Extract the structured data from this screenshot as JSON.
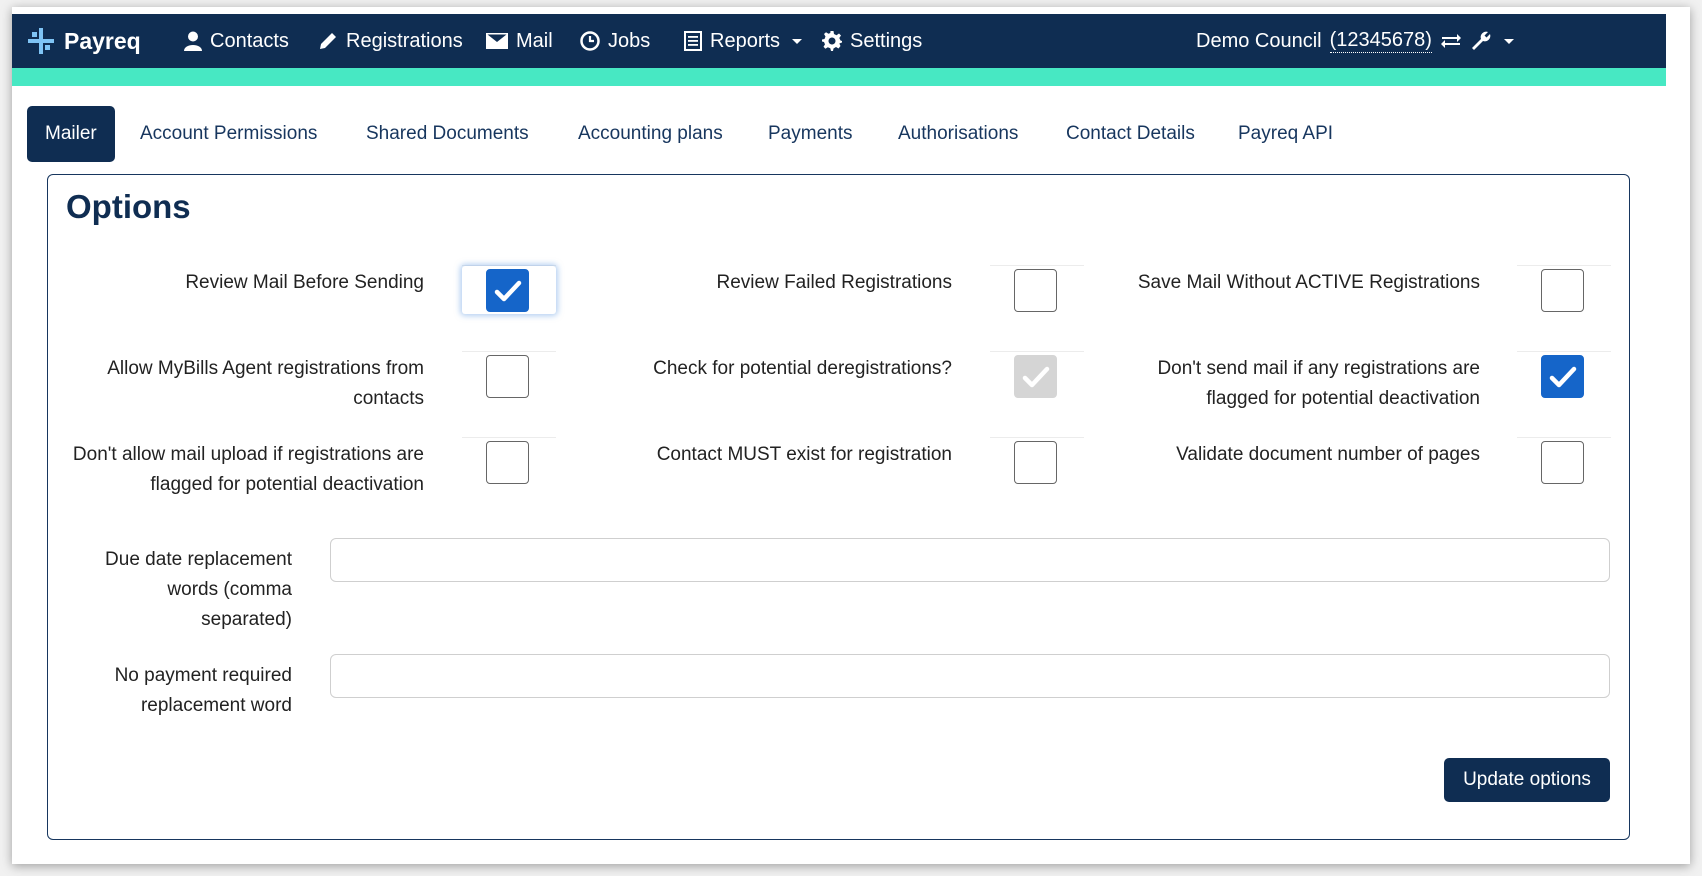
{
  "brand": {
    "name": "Payreq"
  },
  "nav": {
    "contacts": "Contacts",
    "registrations": "Registrations",
    "mail": "Mail",
    "jobs": "Jobs",
    "reports": "Reports",
    "settings": "Settings",
    "council_name": "Demo Council",
    "council_id": "(12345678)"
  },
  "tabs": [
    {
      "label": "Mailer",
      "active": true
    },
    {
      "label": "Account Permissions"
    },
    {
      "label": "Shared Documents"
    },
    {
      "label": "Accounting plans"
    },
    {
      "label": "Payments"
    },
    {
      "label": "Authorisations"
    },
    {
      "label": "Contact Details"
    },
    {
      "label": "Payreq API"
    }
  ],
  "panel": {
    "title": "Options",
    "options": [
      {
        "label": "Review Mail Before Sending",
        "checked": true
      },
      {
        "label": "Review Failed Registrations",
        "checked": false
      },
      {
        "label": "Save Mail Without ACTIVE Registrations",
        "checked": false
      },
      {
        "label": "Allow MyBills Agent registrations from contacts",
        "checked": false
      },
      {
        "label": "Check for potential deregistrations?",
        "checked": true,
        "disabled": true
      },
      {
        "label": "Don't send mail if any registrations are flagged for potential deactivation",
        "checked": true
      },
      {
        "label": "Don't allow mail upload if registrations are flagged for potential deactivation",
        "checked": false
      },
      {
        "label": "Contact MUST exist for registration",
        "checked": false
      },
      {
        "label": "Validate document number of pages",
        "checked": false
      }
    ],
    "due_date_label": "Due date replacement words (comma separated)",
    "due_date_value": "",
    "no_payment_label": "No payment required replacement word",
    "no_payment_value": "",
    "update_button": "Update options"
  },
  "colors": {
    "navy": "#0f2d52",
    "accent": "#47e8c3",
    "checkbox_blue": "#1565c9"
  }
}
